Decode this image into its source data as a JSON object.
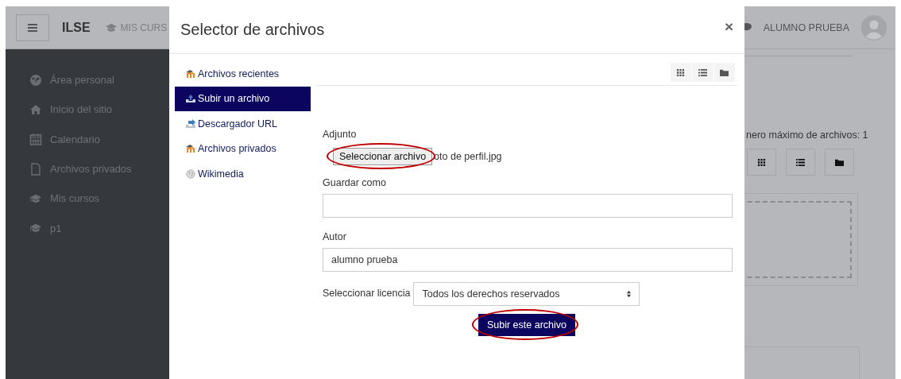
{
  "page": {
    "navbar": {
      "brand": "ILSE",
      "menu_label": "MIS CURS",
      "user_name": "ALUMNO PRUEBA"
    },
    "sidebar": {
      "items": [
        {
          "label": "Área personal"
        },
        {
          "label": "Inicio del sitio"
        },
        {
          "label": "Calendario"
        },
        {
          "label": "Archivos privados"
        },
        {
          "label": "Mis cursos",
          "children": [
            {
              "label": "p1"
            }
          ]
        }
      ]
    },
    "main": {
      "max_files_text": "nero máximo de archivos: 1"
    }
  },
  "dialog": {
    "title": "Selector de archivos",
    "close": "×",
    "repositories": [
      {
        "label": "Archivos recientes",
        "selected": false
      },
      {
        "label": "Subir un archivo",
        "selected": true
      },
      {
        "label": "Descargador URL",
        "selected": false
      },
      {
        "label": "Archivos privados",
        "selected": false
      },
      {
        "label": "Wikimedia",
        "selected": false
      }
    ],
    "form": {
      "attachment_label": "Adjunto",
      "choose_button": {
        "label": "Seleccionar archivo",
        "circled": true
      },
      "file_name": "oto de perfil.jpg",
      "save_as_label": "Guardar como",
      "author_label": "Autor",
      "author_value": "alumno prueba",
      "license_label": "Seleccionar licencia",
      "license_value": "Todos los derechos reservados",
      "upload_button": {
        "label": "Subir este archivo",
        "circled": true
      }
    }
  }
}
